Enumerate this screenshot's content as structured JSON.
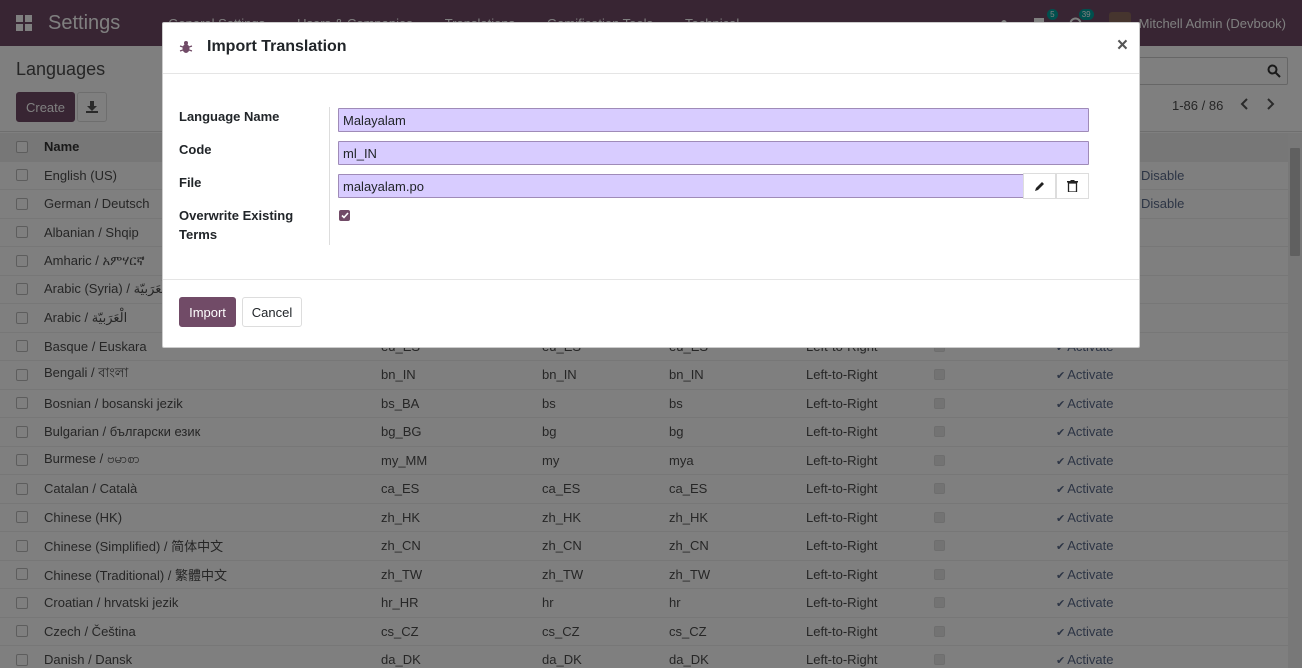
{
  "navbar": {
    "app_title": "Settings",
    "menu": [
      "General Settings",
      "Users & Companies",
      "Translations",
      "Gamification Tools",
      "Technical"
    ],
    "messages_count": "5",
    "activities_count": "39",
    "user_name": "Mitchell Admin (Devbook)"
  },
  "control_panel": {
    "title": "Languages",
    "create_label": "Create",
    "pager": "1-86 / 86"
  },
  "list": {
    "header_name": "Name",
    "action_activate": "Activate",
    "action_disable": "Disable",
    "rows": [
      {
        "name": "English (US)",
        "code": "",
        "iso": "",
        "url": "",
        "dir": "",
        "action": "Disable"
      },
      {
        "name": "German / Deutsch",
        "code": "",
        "iso": "",
        "url": "",
        "dir": "",
        "action": "Disable"
      },
      {
        "name": "Albanian / Shqip",
        "code": "",
        "iso": "",
        "url": "",
        "dir": "",
        "action": ""
      },
      {
        "name": "Amharic / አምሃርኛ",
        "code": "",
        "iso": "",
        "url": "",
        "dir": "",
        "action": ""
      },
      {
        "name": "Arabic (Syria) / الْعَرَبيّة",
        "code": "",
        "iso": "",
        "url": "",
        "dir": "",
        "action": ""
      },
      {
        "name": "Arabic / الْعَرَبيّة",
        "code": "",
        "iso": "",
        "url": "",
        "dir": "",
        "action": ""
      },
      {
        "name": "Basque / Euskara",
        "code": "eu_ES",
        "iso": "eu_ES",
        "url": "eu_ES",
        "dir": "Left-to-Right",
        "action": "Activate"
      },
      {
        "name": "Bengali / বাংলা",
        "code": "bn_IN",
        "iso": "bn_IN",
        "url": "bn_IN",
        "dir": "Left-to-Right",
        "action": "Activate"
      },
      {
        "name": "Bosnian / bosanski jezik",
        "code": "bs_BA",
        "iso": "bs",
        "url": "bs",
        "dir": "Left-to-Right",
        "action": "Activate"
      },
      {
        "name": "Bulgarian / български език",
        "code": "bg_BG",
        "iso": "bg",
        "url": "bg",
        "dir": "Left-to-Right",
        "action": "Activate"
      },
      {
        "name": "Burmese / ဗမာစာ",
        "code": "my_MM",
        "iso": "my",
        "url": "mya",
        "dir": "Left-to-Right",
        "action": "Activate"
      },
      {
        "name": "Catalan / Català",
        "code": "ca_ES",
        "iso": "ca_ES",
        "url": "ca_ES",
        "dir": "Left-to-Right",
        "action": "Activate"
      },
      {
        "name": "Chinese (HK)",
        "code": "zh_HK",
        "iso": "zh_HK",
        "url": "zh_HK",
        "dir": "Left-to-Right",
        "action": "Activate"
      },
      {
        "name": "Chinese (Simplified) / 简体中文",
        "code": "zh_CN",
        "iso": "zh_CN",
        "url": "zh_CN",
        "dir": "Left-to-Right",
        "action": "Activate"
      },
      {
        "name": "Chinese (Traditional) / 繁體中文",
        "code": "zh_TW",
        "iso": "zh_TW",
        "url": "zh_TW",
        "dir": "Left-to-Right",
        "action": "Activate"
      },
      {
        "name": "Croatian / hrvatski jezik",
        "code": "hr_HR",
        "iso": "hr",
        "url": "hr",
        "dir": "Left-to-Right",
        "action": "Activate"
      },
      {
        "name": "Czech / Čeština",
        "code": "cs_CZ",
        "iso": "cs_CZ",
        "url": "cs_CZ",
        "dir": "Left-to-Right",
        "action": "Activate"
      },
      {
        "name": "Danish / Dansk",
        "code": "da_DK",
        "iso": "da_DK",
        "url": "da_DK",
        "dir": "Left-to-Right",
        "action": "Activate"
      }
    ]
  },
  "modal": {
    "title": "Import Translation",
    "close_symbol": "×",
    "fields": {
      "language_name_label": "Language Name",
      "language_name_value": "Malayalam",
      "code_label": "Code",
      "code_value": "ml_IN",
      "file_label": "File",
      "file_value": "malayalam.po",
      "overwrite_label_line1": "Overwrite Existing",
      "overwrite_label_line2": "Terms",
      "overwrite_checked": true
    },
    "import_label": "Import",
    "cancel_label": "Cancel"
  },
  "colors": {
    "brand": "#714B67",
    "input_bg": "#D8CCFF",
    "badge": "#00A09D"
  }
}
